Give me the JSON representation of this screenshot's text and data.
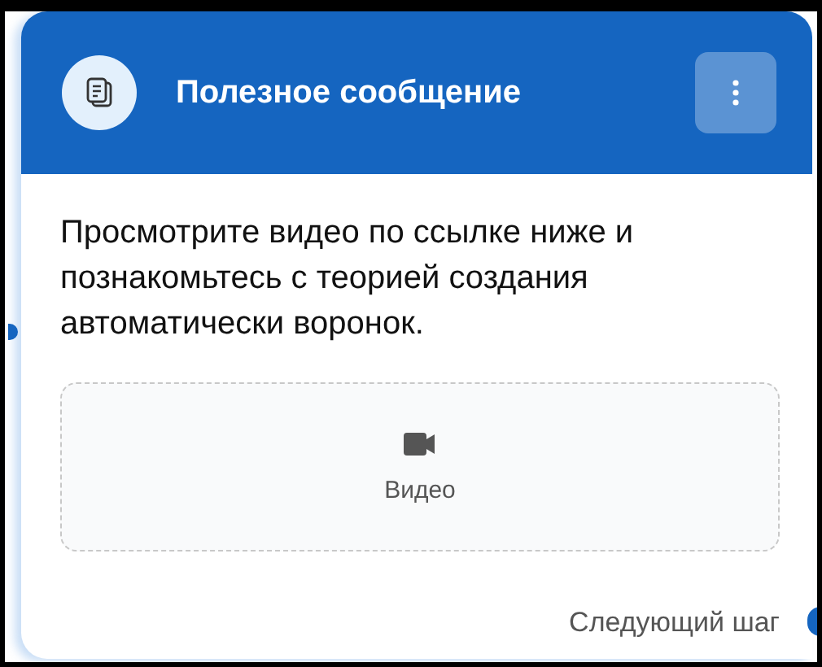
{
  "header": {
    "title": "Полезное сообщение"
  },
  "message": "Просмотрите видео по ссылке ниже и познакомьтесь с теорией создания автоматически воронок.",
  "video": {
    "label": "Видео"
  },
  "next_step": "Следующий шаг"
}
